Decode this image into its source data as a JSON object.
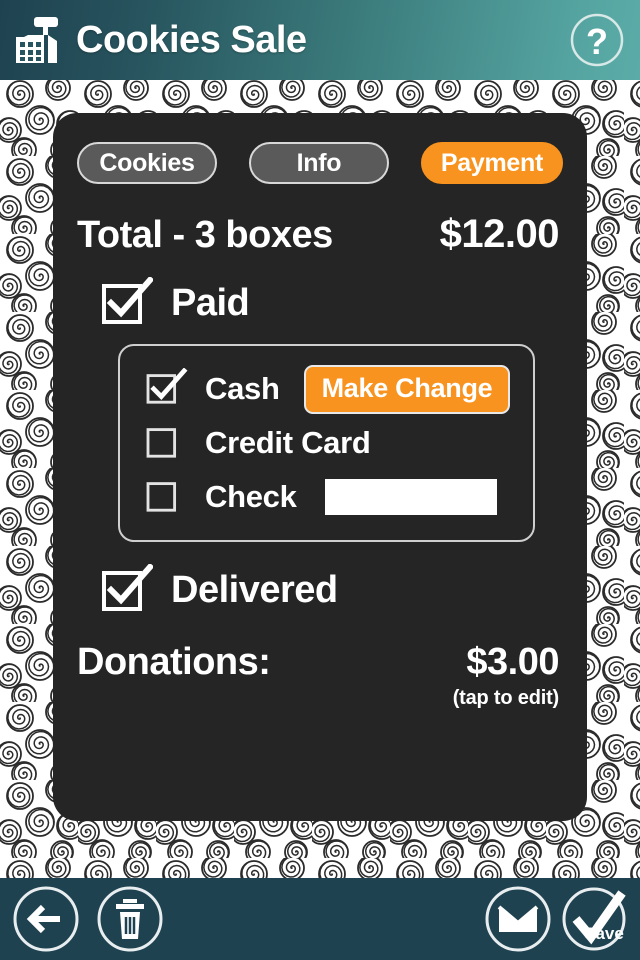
{
  "header": {
    "title": "Cookies Sale",
    "app_icon": "cash-register-icon",
    "help_label": "?",
    "gradient_from": "#1f4250",
    "gradient_to": "#5baca8"
  },
  "tabs": [
    {
      "label": "Cookies",
      "active": false
    },
    {
      "label": "Info",
      "active": false
    },
    {
      "label": "Payment",
      "active": true
    }
  ],
  "order": {
    "total_label": "Total - 3 boxes",
    "total_amount": "$12.00",
    "box_count": 3
  },
  "paid": {
    "label": "Paid",
    "checked": true
  },
  "payment_methods": [
    {
      "label": "Cash",
      "checked": true
    },
    {
      "label": "Credit Card",
      "checked": false
    },
    {
      "label": "Check",
      "checked": false
    }
  ],
  "make_change": {
    "label": "Make Change"
  },
  "check_number": {
    "value": "",
    "placeholder": ""
  },
  "delivered": {
    "label": "Delivered",
    "checked": true
  },
  "donations": {
    "label": "Donations:",
    "amount": "$3.00",
    "hint": "(tap to edit)"
  },
  "toolbar": [
    {
      "name": "back-button",
      "icon": "back-arrow-icon",
      "label": ""
    },
    {
      "name": "delete-button",
      "icon": "trash-icon",
      "label": ""
    },
    {
      "name": "email-button",
      "icon": "envelope-icon",
      "label": ""
    },
    {
      "name": "save-button",
      "icon": "checkmark-icon",
      "label": "Save"
    }
  ],
  "colors": {
    "accent_orange": "#f7931e",
    "card_background": "#252525",
    "toolbar_background": "#1f4250",
    "header_teal": "#4a9a98"
  }
}
